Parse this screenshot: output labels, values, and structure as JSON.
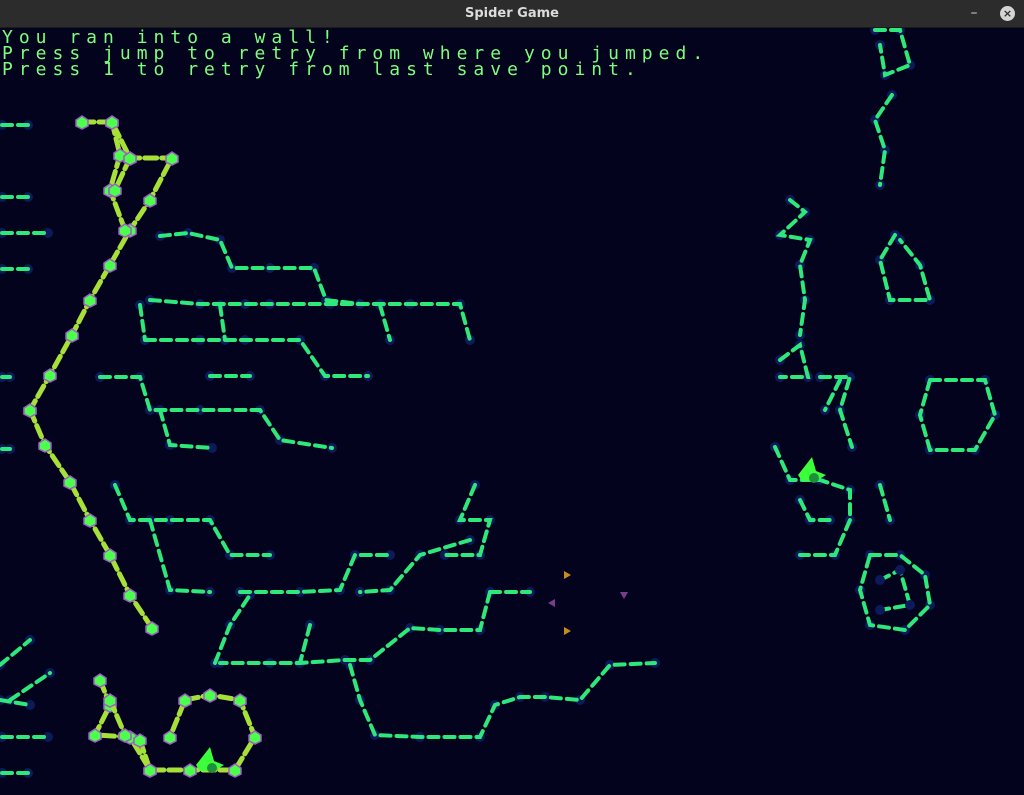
{
  "window": {
    "title": "Spider Game",
    "minimize_glyph": "–",
    "close_glyph": "×"
  },
  "messages": [
    "You ran into a wall!",
    "Press jump to retry from where you jumped.",
    "Press 1 to retry from last save point."
  ],
  "colors": {
    "background": "#03031e",
    "strand": "#2ee87a",
    "strand_light": "#8cffb0",
    "node": "#0d1a5a",
    "web_yellow": "#a8e03a",
    "hex_green": "#4cff4c",
    "hex_purple": "#a05cc8",
    "spider": "#3cff3c",
    "bug_orange": "#c88c1e",
    "bug_purple": "#7a3c8c",
    "text": "#7cff7c"
  },
  "icons": [
    "spider-icon",
    "bug-icon",
    "minimize-icon",
    "close-icon"
  ]
}
